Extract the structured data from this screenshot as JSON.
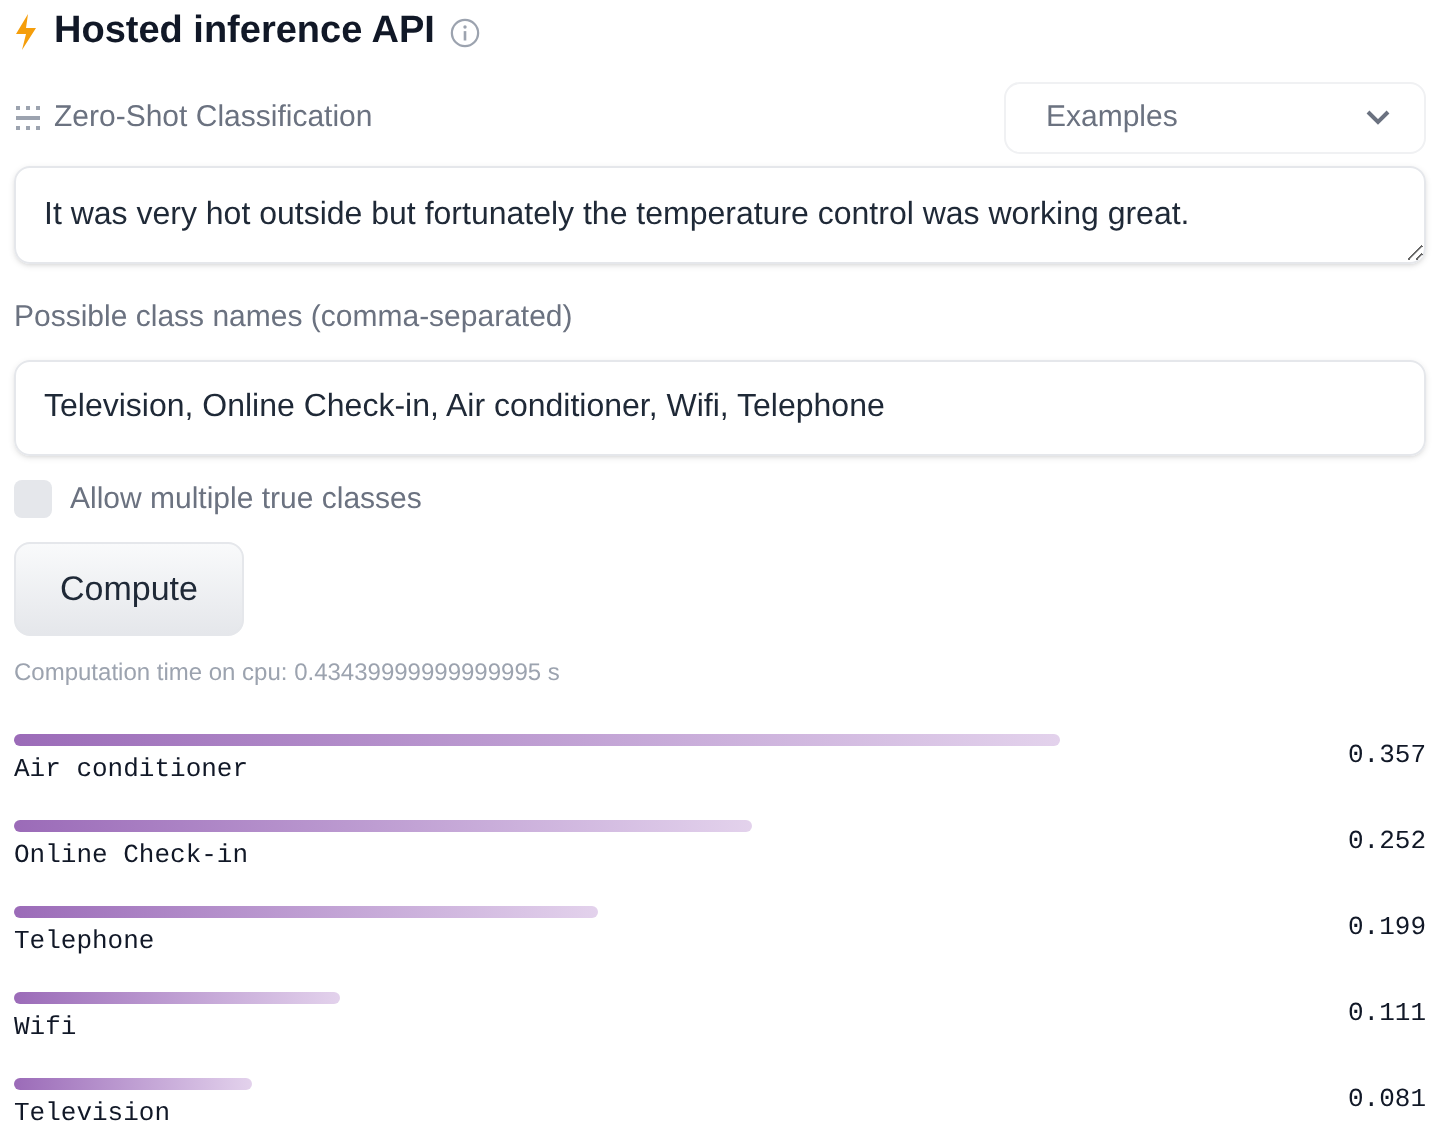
{
  "header": {
    "title": "Hosted inference API"
  },
  "task": {
    "label": "Zero-Shot Classification"
  },
  "examples_dropdown": {
    "label": "Examples"
  },
  "input_text": {
    "value": "It was very hot outside but fortunately the temperature control was working great."
  },
  "class_names": {
    "label": "Possible class names (comma-separated)",
    "value": "Television, Online Check-in, Air conditioner, Wifi, Telephone"
  },
  "multi_class": {
    "label": "Allow multiple true classes",
    "checked": false
  },
  "compute_button": {
    "label": "Compute"
  },
  "computation_time": "Computation time on cpu: 0.43439999999999995 s",
  "results": [
    {
      "label": "Air conditioner",
      "score": "0.357"
    },
    {
      "label": "Online Check-in",
      "score": "0.252"
    },
    {
      "label": "Telephone",
      "score": "0.199"
    },
    {
      "label": "Wifi",
      "score": "0.111"
    },
    {
      "label": "Television",
      "score": "0.081"
    }
  ]
}
